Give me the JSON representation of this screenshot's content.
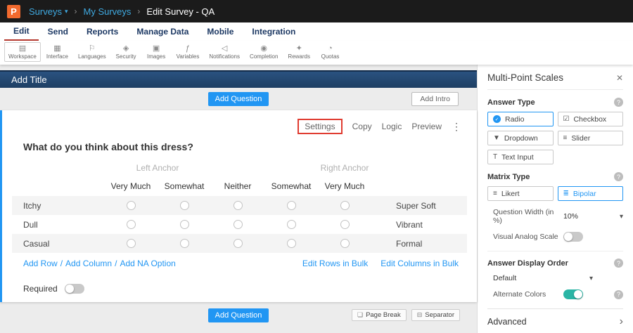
{
  "topbar": {
    "logo": "P",
    "surveys": "Surveys",
    "my_surveys": "My Surveys",
    "current": "Edit Survey - QA"
  },
  "menu": {
    "items": [
      "Edit",
      "Send",
      "Reports",
      "Manage Data",
      "Mobile",
      "Integration"
    ]
  },
  "toolbar": {
    "items": [
      {
        "label": "Workspace",
        "icon": "▤"
      },
      {
        "label": "Interface",
        "icon": "▦"
      },
      {
        "label": "Languages",
        "icon": "⚐"
      },
      {
        "label": "Security",
        "icon": "◈"
      },
      {
        "label": "Images",
        "icon": "▣"
      },
      {
        "label": "Variables",
        "icon": "ƒ"
      },
      {
        "label": "Notifications",
        "icon": "◁"
      },
      {
        "label": "Completion",
        "icon": "◉"
      },
      {
        "label": "Rewards",
        "icon": "✦"
      },
      {
        "label": "Quotas",
        "icon": "◔"
      }
    ]
  },
  "main": {
    "title_bar": "Add Title",
    "add_question_top": "Add Question",
    "add_intro": "Add Intro",
    "question": {
      "actions": {
        "settings": "Settings",
        "copy": "Copy",
        "logic": "Logic",
        "preview": "Preview",
        "menu": "⋮"
      },
      "text": "What do you think about this dress?",
      "matrix": {
        "left_anchor": "Left Anchor",
        "right_anchor": "Right Anchor",
        "columns": [
          "Very Much",
          "Somewhat",
          "Neither",
          "Somewhat",
          "Very Much"
        ],
        "rows": [
          {
            "left": "Itchy",
            "right": "Super Soft"
          },
          {
            "left": "Dull",
            "right": "Vibrant"
          },
          {
            "left": "Casual",
            "right": "Formal"
          }
        ]
      },
      "links": {
        "add_row": "Add Row",
        "add_column": "Add Column",
        "add_na": "Add NA Option",
        "sep": "/",
        "edit_rows": "Edit Rows in Bulk",
        "edit_columns": "Edit Columns in Bulk"
      },
      "required_label": "Required"
    },
    "footer": {
      "add_question": "Add Question",
      "page_break": "Page Break",
      "page_break_icon": "❏",
      "separator": "Separator",
      "separator_icon": "⊟"
    }
  },
  "sidebar": {
    "title": "Multi-Point Scales",
    "close_icon": "✕",
    "help_icon": "?",
    "answer_type": {
      "label": "Answer Type",
      "options": [
        {
          "label": "Radio",
          "icon": "✓",
          "selected": true
        },
        {
          "label": "Checkbox",
          "icon": "☑",
          "selected": false
        },
        {
          "label": "Dropdown",
          "icon": "▼",
          "selected": false
        },
        {
          "label": "Slider",
          "icon": "≡",
          "selected": false
        },
        {
          "label": "Text Input",
          "icon": "T",
          "selected": false
        }
      ]
    },
    "matrix_type": {
      "label": "Matrix Type",
      "options": [
        {
          "label": "Likert",
          "icon": "≡",
          "selected": false
        },
        {
          "label": "Bipolar",
          "icon": "≣",
          "selected": true
        }
      ]
    },
    "question_width": {
      "label": "Question Width (in %)",
      "value": "10%"
    },
    "visual_analog": {
      "label": "Visual Analog Scale",
      "on": false
    },
    "answer_display_order": {
      "label": "Answer Display Order",
      "value": "Default"
    },
    "alternate_colors": {
      "label": "Alternate Colors",
      "on": true
    },
    "advanced": {
      "label": "Advanced",
      "chevron": "›"
    }
  },
  "colors": {
    "accent": "#2196f3",
    "annotation": "#e03c31",
    "toggle_on": "#2ab5a5",
    "brand_orange": "#f26a2e",
    "header_navy": "#1e3f63"
  }
}
